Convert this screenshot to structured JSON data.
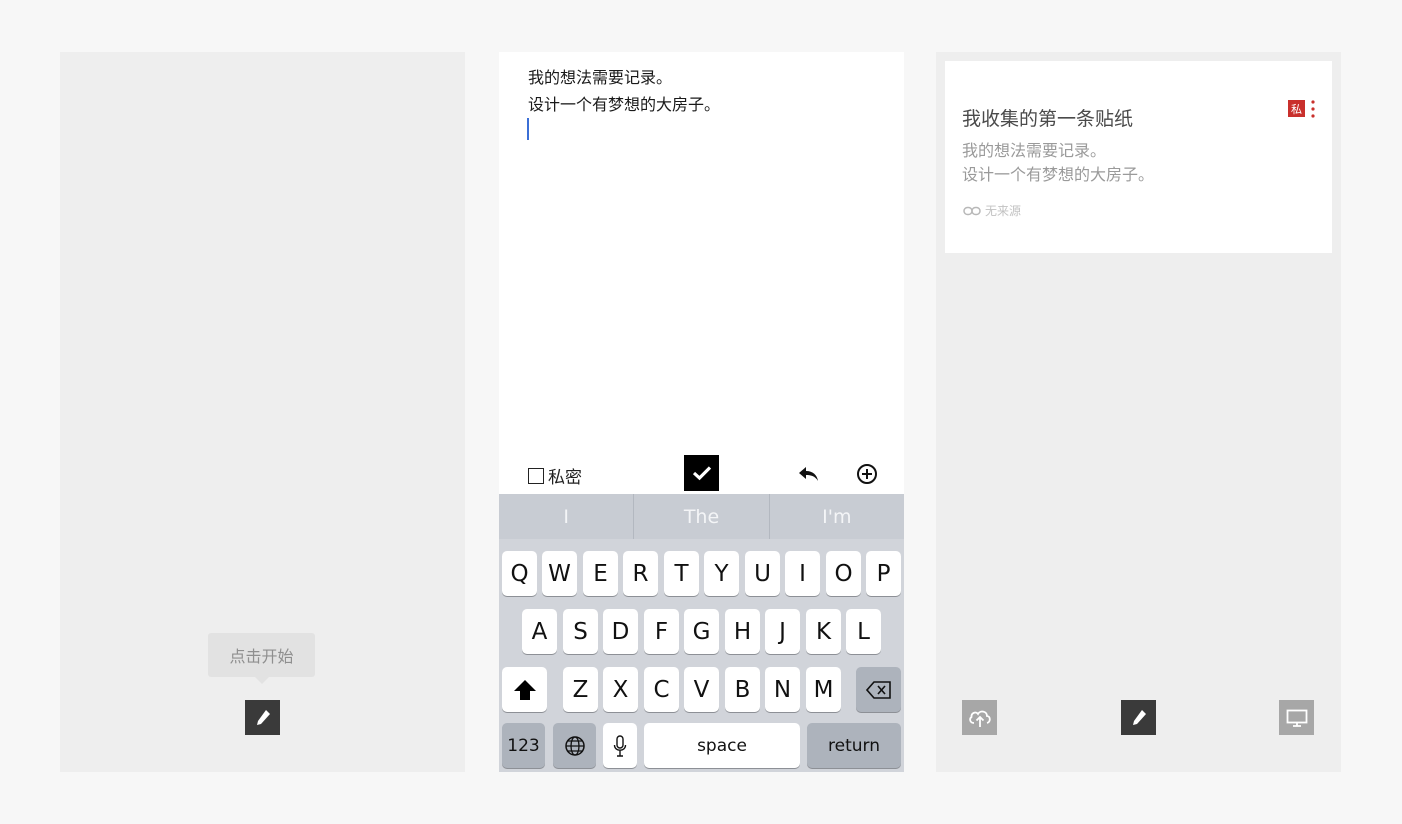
{
  "panel_empty": {
    "tooltip": "点击开始",
    "fab_icon": "pencil-icon"
  },
  "editor": {
    "lines": "我的想法需要记录。\n设计一个有梦想的大房子。",
    "private_label": "私密",
    "confirm_icon": "checkmark-icon",
    "undo_icon": "undo-icon",
    "add_icon": "plus-circle-icon"
  },
  "keyboard": {
    "suggestions": [
      "I",
      "The",
      "I'm"
    ],
    "row1": [
      "Q",
      "W",
      "E",
      "R",
      "T",
      "Y",
      "U",
      "I",
      "O",
      "P"
    ],
    "row2": [
      "A",
      "S",
      "D",
      "F",
      "G",
      "H",
      "J",
      "K",
      "L"
    ],
    "row3": [
      "Z",
      "X",
      "C",
      "V",
      "B",
      "N",
      "M"
    ],
    "numbers": "123",
    "space": "space",
    "return": "return"
  },
  "note_list": {
    "note": {
      "title": "我收集的第一条贴纸",
      "badge": "私",
      "body": "我的想法需要记录。\n设计一个有梦想的大房子。",
      "source": "无来源"
    },
    "bottom_bar": {
      "left_icon": "cloud-upload-icon",
      "center_icon": "pencil-icon",
      "right_icon": "monitor-icon"
    }
  },
  "colors": {
    "badge_red": "#c9302c",
    "caret_blue": "#3b6fd6",
    "fab_dark": "#3a3a3a"
  }
}
